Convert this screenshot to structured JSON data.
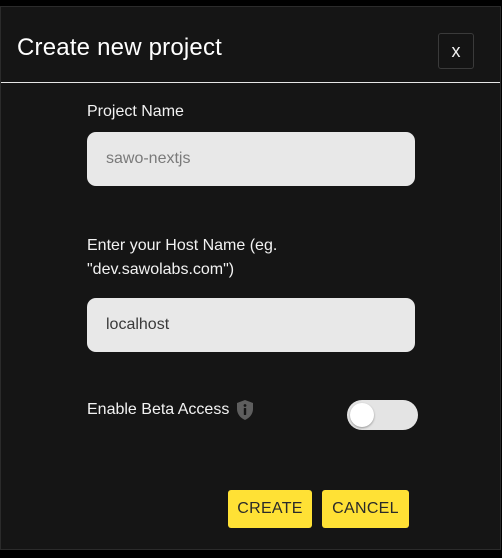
{
  "dialog": {
    "title": "Create new project",
    "close_label": "x"
  },
  "project_name": {
    "label": "Project Name",
    "value": "sawo-nextjs"
  },
  "host_name": {
    "label": "Enter your Host Name (eg. \"dev.sawolabs.com\")",
    "value": "localhost"
  },
  "beta_access": {
    "label": "Enable Beta Access",
    "icon": "info-shield-icon",
    "enabled": false
  },
  "actions": {
    "create_label": "CREATE",
    "cancel_label": "CANCEL"
  },
  "colors": {
    "background": "#151515",
    "accent": "#ffe135",
    "input_bg": "#e8e8e8"
  }
}
